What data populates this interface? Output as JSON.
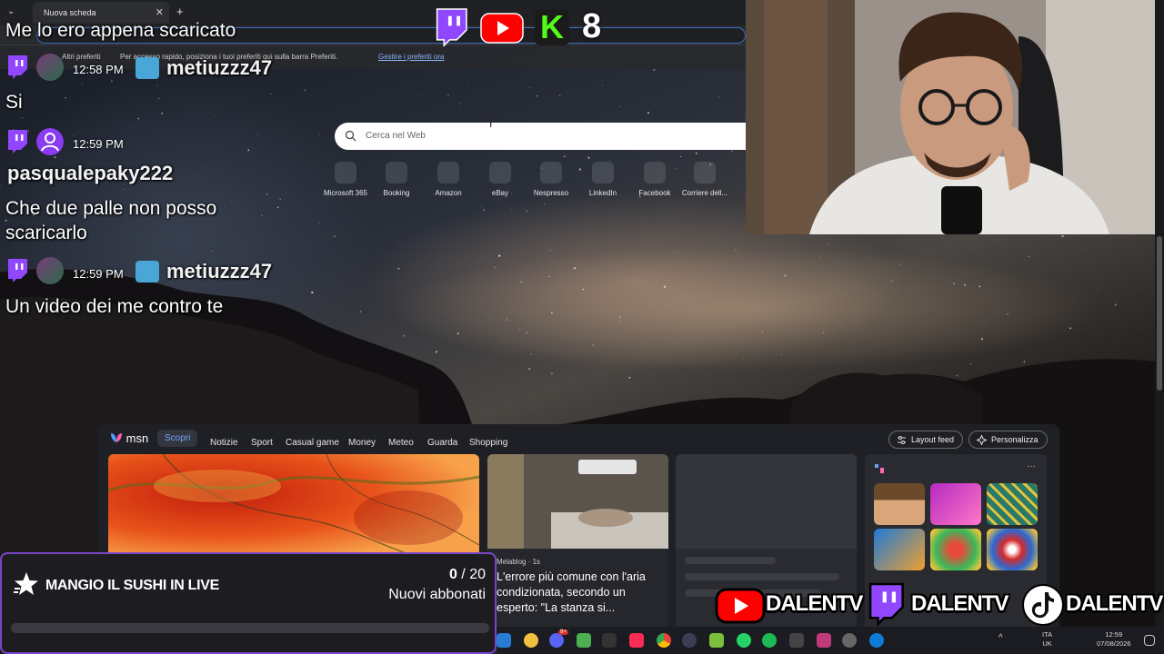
{
  "browser": {
    "tab_title": "Nuova scheda",
    "close_glyph": "✕",
    "new_tab_glyph": "+",
    "chevron_glyph": "⌄",
    "favorites_folder": "Altri preferiti",
    "favorites_hint": "Per accesso rapido, posiziona i tuoi preferiti qui sulla barra Preferiti.",
    "favorites_link": "Gestire i preferiti ora"
  },
  "search": {
    "placeholder": "Cerca nel Web",
    "cursor_glyph": "I"
  },
  "shortcuts": [
    "Microsoft 365",
    "Booking",
    "Amazon",
    "eBay",
    "Nespresso",
    "LinkedIn",
    "Facebook",
    "Corriere dell..."
  ],
  "chat": {
    "messages": [
      {
        "time": "12:58 PM",
        "user": "metiuzzz47",
        "text": "Me lo ero appena scaricato"
      },
      {
        "time": "12:58 PM",
        "user": "metiuzzz47",
        "text": "Si"
      },
      {
        "time": "12:59 PM",
        "user": "pasqualepaky222",
        "text": "Che due palle non posso scaricarlo"
      },
      {
        "time": "12:59 PM",
        "user": "metiuzzz47",
        "text": "Un video dei me contro te"
      }
    ],
    "first_message_line": "Me lo ero appena scaricato",
    "third_message_line1": "Che due palle non posso",
    "third_message_line2": "scaricarlo"
  },
  "top_logos": {
    "kick_letter": "K",
    "number": "8"
  },
  "msn": {
    "brand": "msn",
    "nav": [
      "Scopri",
      "Notizie",
      "Sport",
      "Casual game",
      "Money",
      "Meteo",
      "Guarda",
      "Shopping"
    ],
    "active_tab": "Scopri",
    "layout_button": "Layout feed",
    "personalize_button": "Personalizza",
    "more_glyph": "···",
    "news": {
      "source": "Melablog · 1s",
      "headline": "L'errore più comune con l'aria condizionata, secondo un esperto: \"La stanza si..."
    }
  },
  "goal": {
    "title": "MANGIO IL SUSHI IN LIVE",
    "current": "0",
    "separator": " / ",
    "target": "20",
    "subtitle": "Nuovi abbonati",
    "progress": 0.0
  },
  "socials": [
    {
      "platform": "youtube",
      "name": "DALENTV"
    },
    {
      "platform": "twitch",
      "name": "DALENTV"
    },
    {
      "platform": "tiktok",
      "name": "DALENTV"
    }
  ],
  "taskbar": {
    "language": "ITA",
    "region": "UK",
    "time": "12:59",
    "date": "07/08/2026",
    "notification_count": "9+"
  },
  "colors": {
    "twitch": "#9146ff",
    "youtube": "#ff0000",
    "kick": "#53fc18",
    "goal_border": "#7a45c9",
    "msn_accent": "#74a7ff"
  }
}
